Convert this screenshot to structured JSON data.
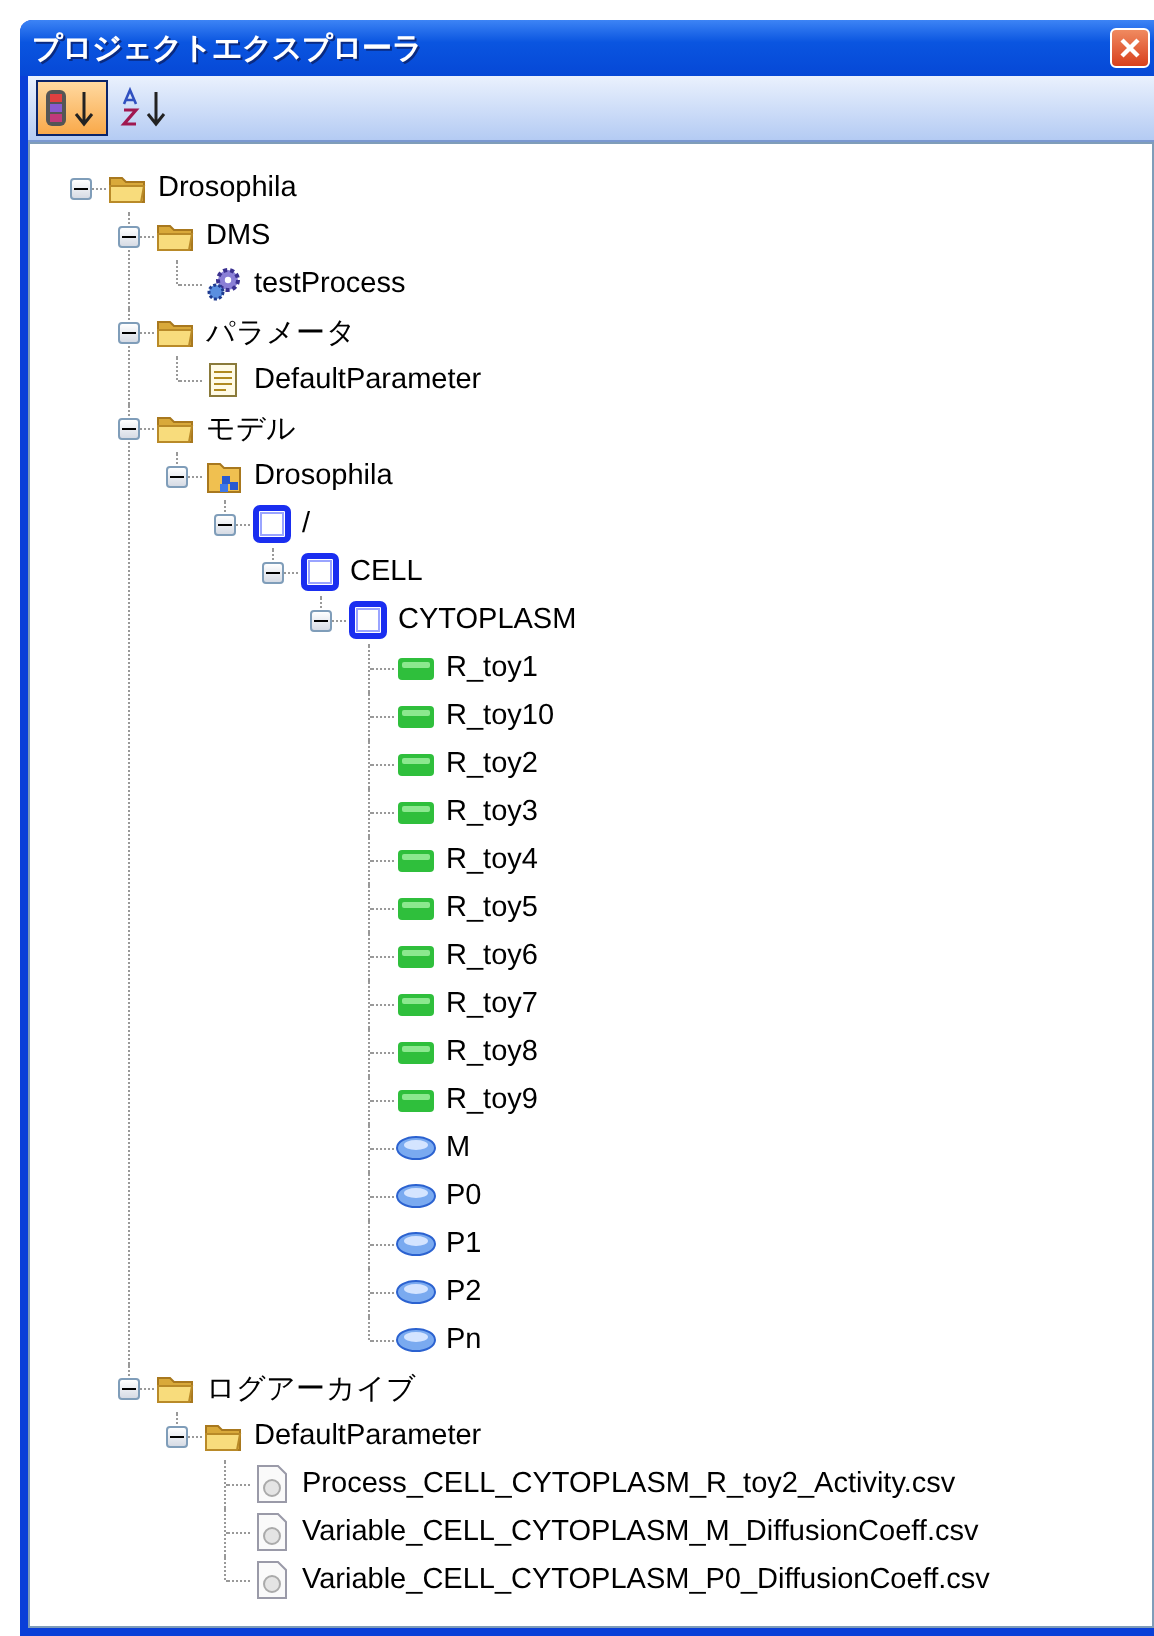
{
  "window": {
    "title": "プロジェクトエクスプローラ"
  },
  "toolbar": [
    {
      "kind": "sort-type",
      "selected": true
    },
    {
      "kind": "sort-alpha",
      "selected": false
    }
  ],
  "tree": [
    {
      "kind": "folder",
      "label": "Drosophila",
      "expanded": true,
      "children": [
        {
          "kind": "folder",
          "label": "DMS",
          "expanded": true,
          "children": [
            {
              "kind": "process",
              "label": "testProcess"
            }
          ]
        },
        {
          "kind": "folder",
          "label": "パラメータ",
          "expanded": true,
          "children": [
            {
              "kind": "parameter",
              "label": "DefaultParameter"
            }
          ]
        },
        {
          "kind": "folder",
          "label": "モデル",
          "expanded": true,
          "children": [
            {
              "kind": "model",
              "label": "Drosophila",
              "expanded": true,
              "children": [
                {
                  "kind": "system",
                  "label": "/",
                  "expanded": true,
                  "children": [
                    {
                      "kind": "system",
                      "label": "CELL",
                      "expanded": true,
                      "children": [
                        {
                          "kind": "system",
                          "label": "CYTOPLASM",
                          "expanded": true,
                          "children": [
                            {
                              "kind": "reaction",
                              "label": "R_toy1"
                            },
                            {
                              "kind": "reaction",
                              "label": "R_toy10"
                            },
                            {
                              "kind": "reaction",
                              "label": "R_toy2"
                            },
                            {
                              "kind": "reaction",
                              "label": "R_toy3"
                            },
                            {
                              "kind": "reaction",
                              "label": "R_toy4"
                            },
                            {
                              "kind": "reaction",
                              "label": "R_toy5"
                            },
                            {
                              "kind": "reaction",
                              "label": "R_toy6"
                            },
                            {
                              "kind": "reaction",
                              "label": "R_toy7"
                            },
                            {
                              "kind": "reaction",
                              "label": "R_toy8"
                            },
                            {
                              "kind": "reaction",
                              "label": "R_toy9"
                            },
                            {
                              "kind": "variable",
                              "label": "M"
                            },
                            {
                              "kind": "variable",
                              "label": "P0"
                            },
                            {
                              "kind": "variable",
                              "label": "P1"
                            },
                            {
                              "kind": "variable",
                              "label": "P2"
                            },
                            {
                              "kind": "variable",
                              "label": "Pn"
                            }
                          ]
                        }
                      ]
                    }
                  ]
                }
              ]
            }
          ]
        },
        {
          "kind": "folder",
          "label": "ログアーカイブ",
          "expanded": true,
          "children": [
            {
              "kind": "folder",
              "label": "DefaultParameter",
              "expanded": true,
              "children": [
                {
                  "kind": "log",
                  "label": "Process_CELL_CYTOPLASM_R_toy2_Activity.csv"
                },
                {
                  "kind": "log",
                  "label": "Variable_CELL_CYTOPLASM_M_DiffusionCoeff.csv"
                },
                {
                  "kind": "log",
                  "label": "Variable_CELL_CYTOPLASM_P0_DiffusionCoeff.csv"
                }
              ]
            }
          ]
        }
      ]
    }
  ]
}
